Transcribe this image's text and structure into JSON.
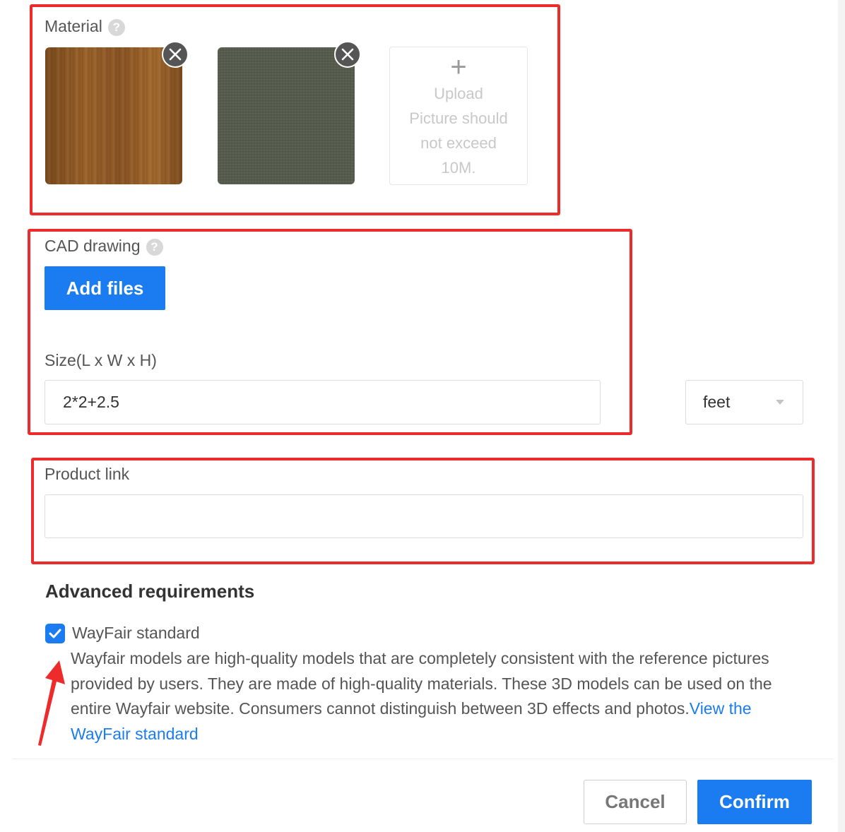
{
  "material": {
    "label": "Material",
    "help_glyph": "?",
    "images": [
      {
        "name": "wood-texture",
        "removable": true
      },
      {
        "name": "fabric-texture",
        "removable": true
      }
    ],
    "upload": {
      "plus": "+",
      "lines": [
        "Upload",
        "Picture should",
        "not exceed",
        "10M."
      ]
    }
  },
  "cad": {
    "label": "CAD drawing",
    "help_glyph": "?",
    "add_files_label": "Add files"
  },
  "size": {
    "label": "Size(L x W x H)",
    "value": "2*2+2.5",
    "unit": "feet"
  },
  "product_link": {
    "label": "Product link",
    "value": ""
  },
  "advanced": {
    "heading": "Advanced requirements",
    "wayfair_checkbox_label": "WayFair standard",
    "wayfair_checked": true,
    "description": "Wayfair models are high-quality models that are completely consistent with the reference pictures provided by users. They are made of high-quality materials. These 3D models can be used on the entire Wayfair website. Consumers cannot distinguish between 3D effects and photos.",
    "link_text": "View the WayFair standard"
  },
  "footer": {
    "cancel_label": "Cancel",
    "confirm_label": "Confirm"
  },
  "colors": {
    "accent": "#1a7cf0",
    "annotation_red": "#ee2b2b"
  }
}
